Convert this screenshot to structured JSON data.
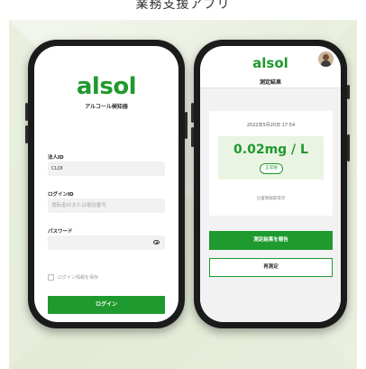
{
  "caption": "業務支援アプリ",
  "login_screen": {
    "logo": "alsol",
    "subtitle": "アルコール検知器",
    "company_label": "法人ID",
    "company_value": "CLOI",
    "login_id_label": "ログインID",
    "login_id_placeholder": "運転者IDまたは電話番号",
    "password_label": "パスワード",
    "remember_label": "ログイン情報を保存",
    "login_button": "ログイン"
  },
  "result_screen": {
    "logo": "alsol",
    "title": "測定結果",
    "datetime": "2022年5月20日 17:54",
    "value": "0.02mg / L",
    "status": "正常値",
    "location_info": "位置情報取得済",
    "report_button": "測定結果を報告",
    "remeasure_button": "再測定"
  },
  "colors": {
    "brand": "#1f9a2e",
    "background": "#eef3e6"
  }
}
